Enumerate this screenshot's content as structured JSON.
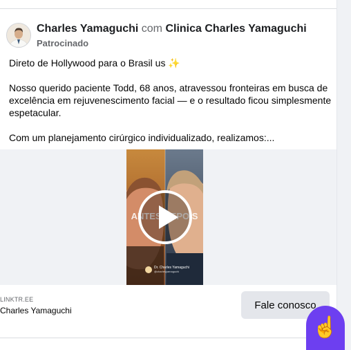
{
  "post": {
    "author": "Charles Yamaguchi",
    "connector": " com ",
    "page": "Clinica Charles Yamaguchi",
    "sponsored": "Patrocinado",
    "line1": "Direto de Hollywood para o Brasil us",
    "line1_emoji": "✨",
    "paragraph2": "Nosso querido paciente Todd, 68 anos, atravessou fronteiras em busca de excelência em rejuvenescimento facial — e o resultado ficou simplesmente espetacular.",
    "paragraph3": "Com um planejamento cirúrgico individualizado, realizamos:..."
  },
  "video": {
    "overlay_text": "ANTES DEPOIS",
    "signature": "Dr. Charles Yamaguchi",
    "handle": "@charlesyamaguchi"
  },
  "link": {
    "domain": "LINKTR.EE",
    "title": "Charles Yamaguchi",
    "cta": "Fale conosco"
  },
  "fab": {
    "emoji": "☝"
  },
  "colors": {
    "fab": "#6d3ff0",
    "cta_bg": "#e4e6eb",
    "secondary_text": "#65676b"
  },
  "icons": {
    "play": "play-icon"
  }
}
